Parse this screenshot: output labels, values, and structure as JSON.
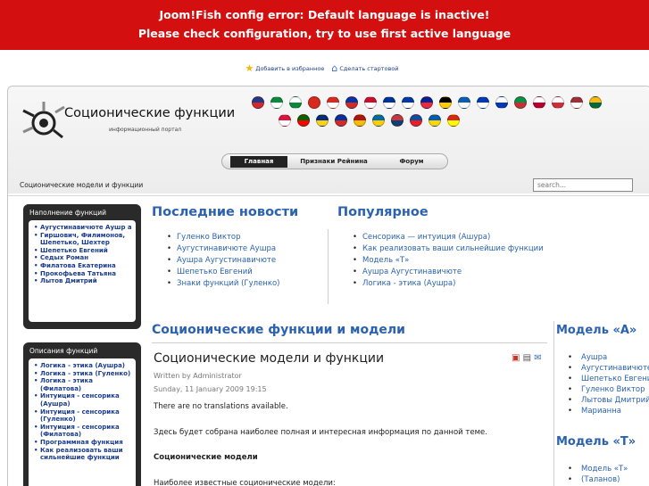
{
  "error": {
    "line1": "Joom!Fish config error: Default language is inactive!",
    "line2": "Please check configuration, try to use first active language"
  },
  "toplinks": {
    "favorites": "Добавить в избранное",
    "homepage": "Сделать стартовой"
  },
  "header": {
    "title": "Соционические функции",
    "subtitle": "информационный портал"
  },
  "flags": [
    {
      "c1": "#1f3c8c",
      "c2": "#d62828"
    },
    {
      "c1": "#0a8a3a",
      "c2": "#ffffff"
    },
    {
      "c1": "#ffffff",
      "c2": "#0a8a3a"
    },
    {
      "c1": "#d52b1e",
      "c2": "#d52b1e"
    },
    {
      "c1": "#d52b1e",
      "c2": "#ffffff"
    },
    {
      "c1": "#0035ad",
      "c2": "#d52b1e"
    },
    {
      "c1": "#c8102e",
      "c2": "#ffffff"
    },
    {
      "c1": "#003399",
      "c2": "#ffffff"
    },
    {
      "c1": "#0039a6",
      "c2": "#ffffff"
    },
    {
      "c1": "#002395",
      "c2": "#ed2939"
    },
    {
      "c1": "#000000",
      "c2": "#ffce00"
    },
    {
      "c1": "#0d5eaf",
      "c2": "#ffffff"
    },
    {
      "c1": "#0038b8",
      "c2": "#ffffff"
    },
    {
      "c1": "#ffffff",
      "c2": "#0038b8"
    },
    {
      "c1": "#009246",
      "c2": "#ce2b37"
    },
    {
      "c1": "#ffffff",
      "c2": "#bc002d"
    },
    {
      "c1": "#ffffff",
      "c2": "#cd2e3a"
    },
    {
      "c1": "#9e3039",
      "c2": "#ffffff"
    },
    {
      "c1": "#fdb913",
      "c2": "#006a44"
    },
    {
      "c1": "#dc143c",
      "c2": "#ffffff"
    },
    {
      "c1": "#006600",
      "c2": "#ff0000"
    },
    {
      "c1": "#002b7f",
      "c2": "#fcd116"
    },
    {
      "c1": "#0033a0",
      "c2": "#d52b1e"
    },
    {
      "c1": "#aa151b",
      "c2": "#f1bf00"
    },
    {
      "c1": "#006aa7",
      "c2": "#fecc00"
    },
    {
      "c1": "#c6363c",
      "c2": "#0c4076"
    },
    {
      "c1": "#0b4ea2",
      "c2": "#ee1c25"
    },
    {
      "c1": "#005bbb",
      "c2": "#ffd500"
    },
    {
      "c1": "#da251d",
      "c2": "#ffff00"
    }
  ],
  "nav": {
    "home": "Главная",
    "reinin": "Признаки Рейнина",
    "forum": "Форум"
  },
  "breadcrumb": "Соционические модели и функции",
  "search": {
    "placeholder": "search..."
  },
  "modules": [
    {
      "title": "Наполнение функций",
      "items": [
        "Аугустинавичюте Аушр а",
        "Гиршович, Филимонов, Шепетько, Шехтер",
        "Шепетько Евгений",
        "Седых Роман",
        "Филатова Екатерина",
        "Прокофьева Татьяна",
        "Лытов Дмитрий"
      ]
    },
    {
      "title": "Описания функций",
      "items": [
        "Логика - этика (Аушра)",
        "Логика - этика (Гуленко)",
        "Логика - этика (Филатова)",
        "Интуиция - сенсорика (Аушра)",
        "Интуиция - сенсорика (Гуленко)",
        "Интуиция - сенсорика (Филатова)",
        "Программная функция",
        "Как реализовать ваши сильнейшие функции"
      ]
    }
  ],
  "latest": {
    "title": "Последние новости",
    "items": [
      "Гуленко Виктор",
      "Аугустинавичюте Аушра",
      "Аушра Аугустинавичюте",
      "Шепетько Евгений",
      "Знаки функций (Гуленко)"
    ]
  },
  "popular": {
    "title": "Популярное",
    "items": [
      "Сенсорика — интуиция (Ашура)",
      "Как реализовать ваши сильнейшие функции",
      "Модель «Т»",
      "Аушра Аугустинавичюте",
      "Логика - этика (Аушра)"
    ]
  },
  "article": {
    "section": "Соционические функции и модели",
    "title": "Соционические модели и функции",
    "author": "Written by Administrator",
    "date": "Sunday, 11 January 2009 19:15",
    "p1": "There are no translations available.",
    "p2": "Здесь будет собрана наиболее полная и интересная информация по данной теме.",
    "h": "Соционические модели",
    "p3": "Наиболее известные соционические модели:"
  },
  "model_a": {
    "title": "Модель «А»",
    "items": [
      "Аушра",
      "Аугустинавичюте",
      "Шепетько Евгений",
      "Гуленко Виктор",
      "Лытовы Дмитрий",
      "Марианна"
    ]
  },
  "model_t": {
    "title": "Модель «Т»",
    "items": [
      "Модель «Т»",
      "(Таланов)"
    ]
  }
}
